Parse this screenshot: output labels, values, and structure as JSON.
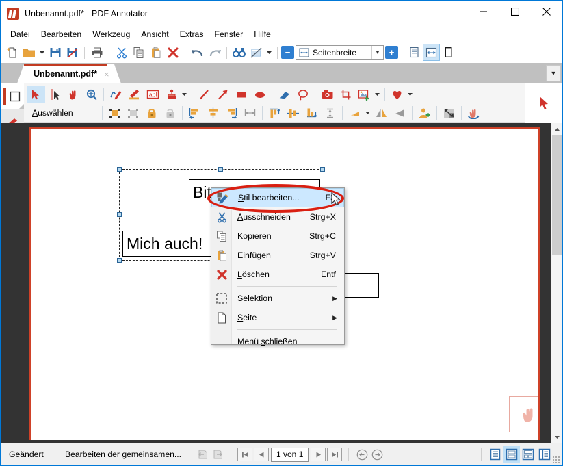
{
  "window": {
    "title": "Unbenannt.pdf* - PDF Annotator",
    "app_icon": "pdf-annotator-icon",
    "minimize_label": "Minimieren",
    "maximize_label": "Maximieren",
    "close_label": "Schließen"
  },
  "menubar": {
    "items": [
      {
        "label": "Datei",
        "accel": "D"
      },
      {
        "label": "Bearbeiten",
        "accel": "B"
      },
      {
        "label": "Werkzeug",
        "accel": "W"
      },
      {
        "label": "Ansicht",
        "accel": "A"
      },
      {
        "label": "Extras",
        "accel": "x"
      },
      {
        "label": "Fenster",
        "accel": "F"
      },
      {
        "label": "Hilfe",
        "accel": "H"
      }
    ]
  },
  "main_toolbar": {
    "buttons": [
      {
        "name": "new-document-icon",
        "label": "Neu"
      },
      {
        "name": "open-folder-icon",
        "label": "Öffnen"
      },
      {
        "name": "open-dropdown-icon",
        "label": "Öffnen Optionen"
      },
      {
        "name": "save-icon",
        "label": "Speichern"
      },
      {
        "name": "save-as-icon",
        "label": "Speichern unter"
      },
      {
        "name": "print-icon",
        "label": "Drucken"
      },
      {
        "name": "cut-icon",
        "label": "Ausschneiden"
      },
      {
        "name": "copy-icon",
        "label": "Kopieren"
      },
      {
        "name": "paste-icon",
        "label": "Einfügen"
      },
      {
        "name": "delete-icon",
        "label": "Löschen"
      },
      {
        "name": "undo-icon",
        "label": "Rückgängig"
      },
      {
        "name": "redo-icon",
        "label": "Wiederholen"
      },
      {
        "name": "find-icon",
        "label": "Suchen"
      },
      {
        "name": "chart-tool-icon",
        "label": "Werkzeug"
      },
      {
        "name": "chart-tool-dropdown-icon",
        "label": "Werkzeug Optionen"
      }
    ],
    "zoom_out_label": "−",
    "zoom_in_label": "+",
    "zoom_value": "Seitenbreite",
    "zoom_icon": "fit-width-icon",
    "view_buttons": [
      {
        "name": "single-page-view-icon",
        "selected": false
      },
      {
        "name": "fit-width-view-icon",
        "selected": true
      },
      {
        "name": "full-page-view-icon",
        "selected": false
      }
    ]
  },
  "tabstrip": {
    "tab_label": "Unbenannt.pdf*",
    "tab_close": "×",
    "overflow_arrow": "▼"
  },
  "anno_toolbar": {
    "mode_label": "Auswählen",
    "mode_accel": "A",
    "row1": [
      {
        "name": "select-arrow-icon",
        "selected": true
      },
      {
        "name": "text-select-icon",
        "selected": false
      },
      {
        "name": "pan-hand-icon",
        "selected": false
      },
      {
        "name": "zoom-magnifier-icon",
        "selected": false
      },
      {
        "name": "pen-icon",
        "selected": false
      },
      {
        "name": "highlighter-icon",
        "selected": false
      },
      {
        "name": "text-abl-icon",
        "selected": false
      },
      {
        "name": "stamp-icon",
        "selected": false
      },
      {
        "name": "stamp-dropdown-icon",
        "selected": false
      },
      {
        "name": "line-icon",
        "selected": false
      },
      {
        "name": "arrow-icon",
        "selected": false
      },
      {
        "name": "rectangle-icon",
        "selected": false
      },
      {
        "name": "ellipse-icon",
        "selected": false
      },
      {
        "name": "eraser-icon",
        "selected": false
      },
      {
        "name": "lasso-icon",
        "selected": false
      },
      {
        "name": "camera-icon",
        "selected": false
      },
      {
        "name": "crop-icon",
        "selected": false
      },
      {
        "name": "image-add-icon",
        "selected": false
      },
      {
        "name": "image-add-dropdown-icon",
        "selected": false
      },
      {
        "name": "favorite-heart-icon",
        "selected": false
      },
      {
        "name": "favorite-dropdown-icon",
        "selected": false
      }
    ],
    "row2": [
      {
        "name": "group-icon"
      },
      {
        "name": "ungroup-icon"
      },
      {
        "name": "lock-icon"
      },
      {
        "name": "unlock-icon"
      },
      {
        "name": "align-left-icon"
      },
      {
        "name": "align-center-icon"
      },
      {
        "name": "align-right-icon"
      },
      {
        "name": "distribute-horizontal-icon"
      },
      {
        "name": "align-top-icon"
      },
      {
        "name": "align-middle-icon"
      },
      {
        "name": "align-bottom-icon"
      },
      {
        "name": "distribute-vertical-icon"
      },
      {
        "name": "rotate-left-icon"
      },
      {
        "name": "rotate-dropdown-icon"
      },
      {
        "name": "flip-horizontal-icon"
      },
      {
        "name": "flip-vertical-icon"
      },
      {
        "name": "mirror-icon"
      },
      {
        "name": "add-user-icon"
      },
      {
        "name": "resize-icon"
      },
      {
        "name": "hand-stamp-icon"
      }
    ],
    "right_panel_icon": "cursor-arrow-icon"
  },
  "left_rail": {
    "items": [
      {
        "name": "rail-rectangle-icon",
        "state": "white"
      },
      {
        "name": "rail-highlighter-icon",
        "state": "light"
      },
      {
        "name": "rail-folder-icon",
        "state": "light"
      },
      {
        "name": "rail-paperclip-icon",
        "state": "light"
      },
      {
        "name": "rail-favorite-heart-icon",
        "state": "white"
      },
      {
        "name": "rail-pen-blue-icon",
        "state": "light"
      },
      {
        "name": "rail-pencil-icon",
        "state": "light"
      },
      {
        "name": "rail-text-abl-icon",
        "state": "light"
      },
      {
        "name": "rail-stamp-icon",
        "state": "light"
      },
      {
        "name": "rail-arrow-icon",
        "state": "light"
      }
    ]
  },
  "document": {
    "annotations": [
      {
        "name": "text-annotation-bitte",
        "text": "Bitte ändern!"
      },
      {
        "name": "text-annotation-mich",
        "text": "Mich auch!"
      },
      {
        "name": "empty-annotation-box",
        "text": ""
      }
    ],
    "hand_stamp_icon": "hand-stamp-icon",
    "selection_handles": 6
  },
  "context_menu": {
    "items": [
      {
        "label": "Stil bearbeiten...",
        "accel": "S",
        "key": "F3",
        "icon": "edit-style-icon",
        "highlighted": true,
        "submenu": false
      },
      {
        "label": "Ausschneiden",
        "accel": "A",
        "key": "Strg+X",
        "icon": "cut-scissors-icon",
        "highlighted": false,
        "submenu": false
      },
      {
        "label": "Kopieren",
        "accel": "K",
        "key": "Strg+C",
        "icon": "copy-icon",
        "highlighted": false,
        "submenu": false
      },
      {
        "label": "Einfügen",
        "accel": "E",
        "key": "Strg+V",
        "icon": "paste-icon",
        "highlighted": false,
        "submenu": false
      },
      {
        "label": "Löschen",
        "accel": "L",
        "key": "Entf",
        "icon": "delete-x-icon",
        "highlighted": false,
        "submenu": false
      },
      {
        "label": "Selektion",
        "accel": "e",
        "key": "",
        "icon": "selection-icon",
        "highlighted": false,
        "submenu": true
      },
      {
        "label": "Seite",
        "accel": "S",
        "key": "",
        "icon": "page-icon",
        "highlighted": false,
        "submenu": true
      },
      {
        "label": "Menü schließen",
        "accel": "s",
        "key": "",
        "icon": "",
        "highlighted": false,
        "submenu": false
      }
    ],
    "submenu_arrow": "▶",
    "highlight_ellipse_color": "#d91f11"
  },
  "statusbar": {
    "status_text": "Geändert",
    "action_text": "Bearbeiten der gemeinsamen...",
    "page_indicator": "1 von 1",
    "nav_first": "first-page-icon",
    "nav_prev": "previous-page-icon",
    "nav_next": "next-page-icon",
    "nav_last": "last-page-icon",
    "back_icon": "navigate-back-icon",
    "forward_icon": "navigate-forward-icon",
    "undo_view_icon": "undo-view-icon",
    "redo_view_icon": "redo-view-icon",
    "view_modes": [
      {
        "name": "view-single-column-icon",
        "selected": false
      },
      {
        "name": "view-two-rows-icon",
        "selected": true
      },
      {
        "name": "view-grid-icon",
        "selected": false
      },
      {
        "name": "view-list-icon",
        "selected": false
      }
    ]
  },
  "colors": {
    "accent": "#0078d7",
    "brand_red": "#c23b22",
    "highlight_blue": "#cce8ff",
    "toolbar_orange": "#e8a33d",
    "page_border_red": "#cf4128"
  }
}
